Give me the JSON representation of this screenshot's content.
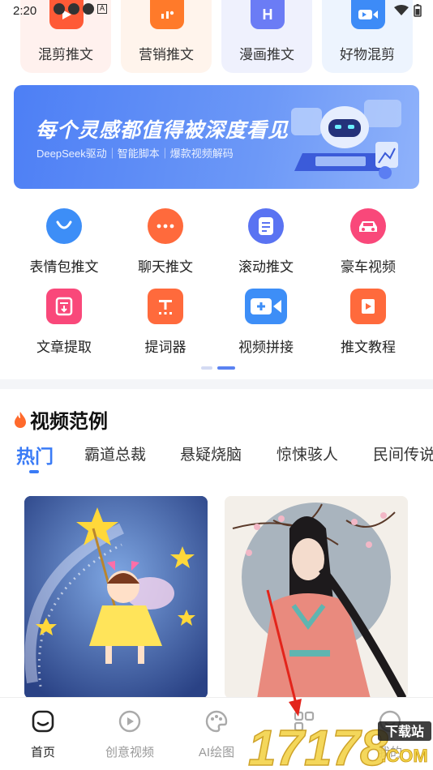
{
  "status_bar": {
    "time": "2:20"
  },
  "top_cards": [
    {
      "label": "混剪推文",
      "icon": "play-icon",
      "color": "#ff5a36",
      "bg": "#fff1ee"
    },
    {
      "label": "营销推文",
      "icon": "chart-bubble-icon",
      "color": "#ff7a2a",
      "bg": "#fff4ec"
    },
    {
      "label": "漫画推文",
      "icon": "h-letter-icon",
      "color": "#6b7cf5",
      "bg": "#eff1fd"
    },
    {
      "label": "好物混剪",
      "icon": "video-camera-icon",
      "color": "#3d8bf7",
      "bg": "#edf4fe"
    }
  ],
  "banner": {
    "title": "每个灵感都值得被深度看见",
    "subtitle": "DeepSeek驱动｜智能脚本｜爆款视频解码"
  },
  "functions": [
    {
      "label": "表情包推文",
      "icon": "smile-icon",
      "color": "#3d8ef7"
    },
    {
      "label": "聊天推文",
      "icon": "chat-bubble-icon",
      "color": "#ff6a3c"
    },
    {
      "label": "滚动推文",
      "icon": "document-icon",
      "color": "#5a73f2"
    },
    {
      "label": "豪车视频",
      "icon": "car-icon",
      "color": "#f9487a"
    },
    {
      "label": "文章提取",
      "icon": "article-extract-icon",
      "color": "#f9487a"
    },
    {
      "label": "提词器",
      "icon": "teleprompter-icon",
      "color": "#ff6a3c"
    },
    {
      "label": "视频拼接",
      "icon": "video-add-icon",
      "color": "#3d8ef7"
    },
    {
      "label": "推文教程",
      "icon": "book-icon",
      "color": "#ff6a3c"
    }
  ],
  "section": {
    "title": "视频范例"
  },
  "tabs": [
    "热门",
    "霸道总裁",
    "悬疑烧脑",
    "惊悚骇人",
    "民间传说"
  ],
  "active_tab": "热门",
  "bottom_nav": [
    {
      "label": "首页",
      "icon": "home-icon",
      "active": true
    },
    {
      "label": "创意视频",
      "icon": "play-circle-icon",
      "active": false
    },
    {
      "label": "AI绘图",
      "icon": "palette-icon",
      "active": false
    },
    {
      "label": "",
      "icon": "grid-icon",
      "active": false
    },
    {
      "label": "我的",
      "icon": "profile-icon",
      "active": false
    }
  ],
  "watermark": {
    "text": "17178",
    "badge": "下载站",
    "suffix": ".COM"
  }
}
